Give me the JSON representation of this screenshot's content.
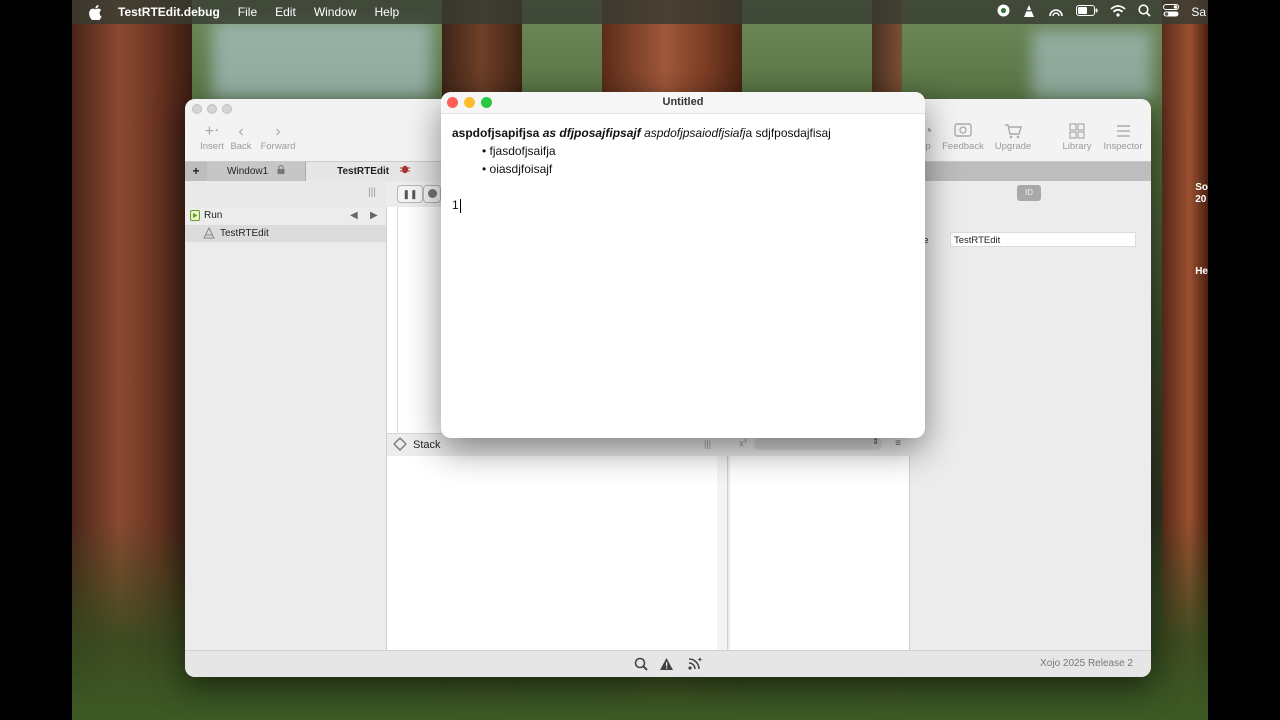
{
  "menubar": {
    "app_name": "TestRTEdit.debug",
    "items": [
      "File",
      "Edit",
      "Window",
      "Help"
    ],
    "user_partial": "Sa"
  },
  "ide": {
    "toolbar": {
      "insert": "Insert",
      "back": "Back",
      "forward": "Forward",
      "feedback": "Feedback",
      "upgrade": "Upgrade",
      "library": "Library",
      "inspector": "Inspector",
      "partial_left": "p"
    },
    "tabs": {
      "add": "+",
      "window1": "Window1",
      "testrtedit": "TestRTEdit"
    },
    "navigator": {
      "run_label": "Run",
      "item_label": "TestRTEdit"
    },
    "lower": {
      "stack_label": "Stack"
    },
    "inspector": {
      "name_label_partial": "ame",
      "name_value": "TestRTEdit"
    },
    "status": {
      "version": "Xojo 2025 Release 2"
    }
  },
  "desktop_partials": {
    "a": "So",
    "b": "20",
    "c": "He"
  },
  "doc_window": {
    "title": "Untitled",
    "line1": {
      "bold": "aspdofjsapifjsa ",
      "bold_italic": "as dfjposajfipsajf ",
      "italic": "aspdofjpsaiodfjsiafj",
      "plain": "a sdjfposdajfisaj"
    },
    "bullets": [
      "• fjasdofjsaifja",
      "• oiasdjfoisajf"
    ],
    "last_line": "1"
  },
  "colors": {
    "close": "#ff5f57",
    "minimize": "#febc2e",
    "zoom": "#28c840"
  }
}
